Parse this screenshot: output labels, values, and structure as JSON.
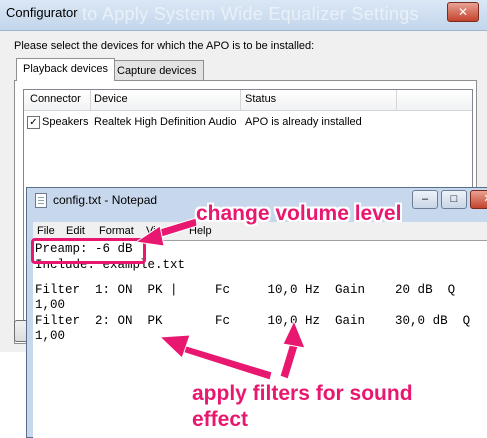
{
  "configurator": {
    "title": "Configurator",
    "ghost_title": "to Apply System Wide Equalizer Settings",
    "close_glyph": "✕",
    "prompt": "Please select the devices for which the APO is to be installed:",
    "tabs": [
      "Playback devices",
      "Capture devices"
    ],
    "columns": [
      "Connector",
      "Device",
      "Status"
    ],
    "rows": [
      {
        "checked": true,
        "connector": "Speakers",
        "device": "Realtek High Definition Audio",
        "status": "APO is already installed"
      }
    ]
  },
  "notepad": {
    "title": "config.txt - Notepad",
    "controls": {
      "minimize": "–",
      "maximize": "□",
      "close": "✕"
    },
    "menu": [
      "File",
      "Edit",
      "Format",
      "View",
      "Help"
    ],
    "lines": [
      "Preamp: -6 dB",
      "Include: example.txt",
      "",
      "Filter  1: ON  PK |     Fc     10,0 Hz  Gain    20 dB  Q",
      "1,00",
      "Filter  2: ON  PK       Fc     10,0 Hz  Gain    30,0 dB  Q",
      "1,00"
    ]
  },
  "annotations": {
    "volume": "change volume level",
    "filters_line1": "apply filters for sound",
    "filters_line2": "effect",
    "color": "#e8176f"
  }
}
